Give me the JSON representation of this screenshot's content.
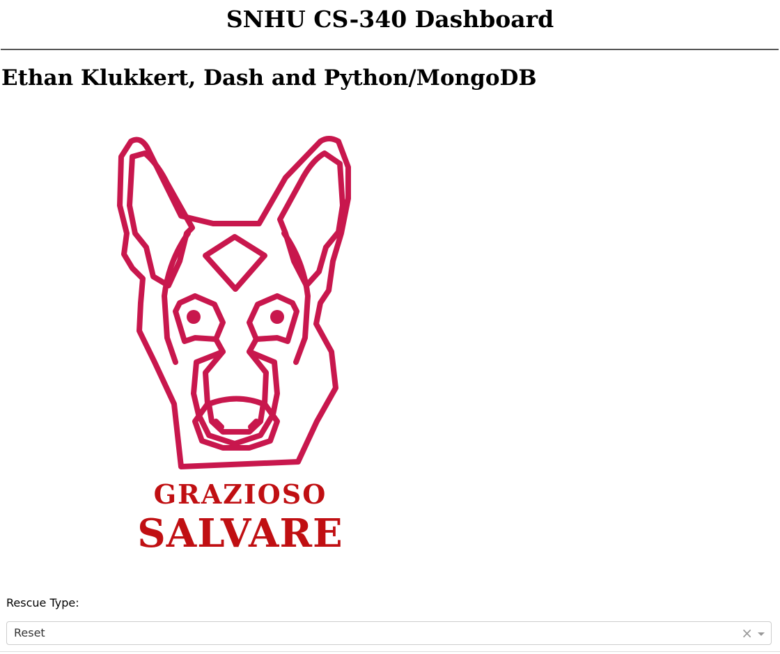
{
  "header": {
    "title": "SNHU CS-340 Dashboard"
  },
  "author": {
    "heading": "Ethan Klukkert, Dash and Python/MongoDB"
  },
  "logo": {
    "line1": "GRAZIOSO",
    "line2": "SALVARE",
    "icon": "dog-head-icon",
    "dog_color": "#c8174d",
    "text_color": "#c00f12"
  },
  "filter": {
    "label": "Rescue Type:",
    "selected": "Reset",
    "clear_glyph": "×"
  },
  "colors": {
    "rule": "#555555",
    "dropdown_border": "#cccccc"
  }
}
